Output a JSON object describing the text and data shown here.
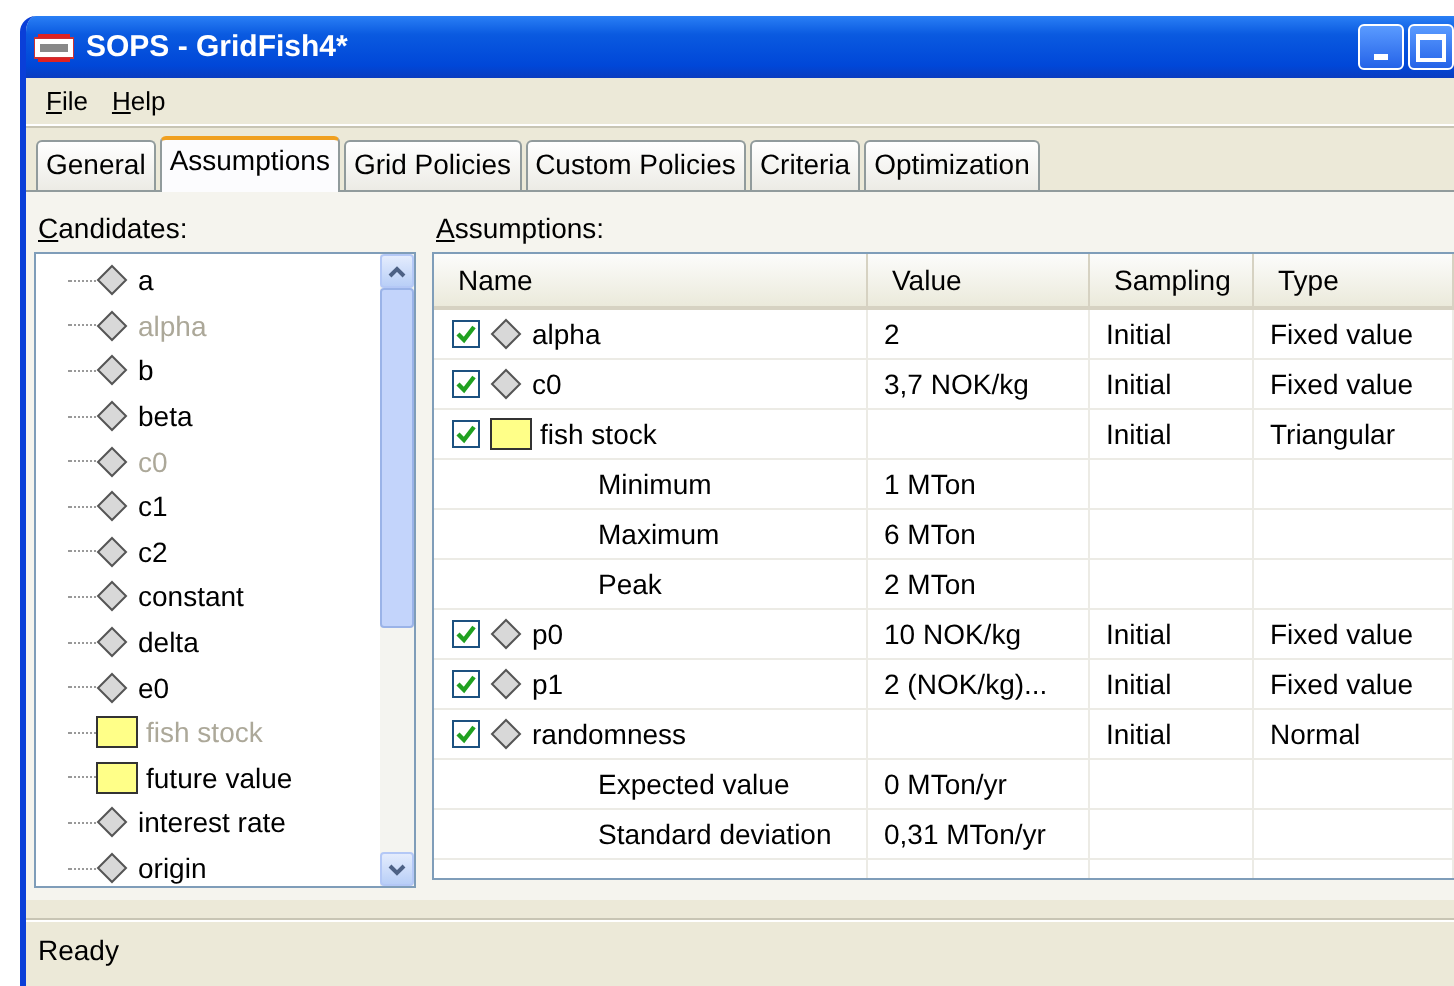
{
  "window": {
    "title": "SOPS - GridFish4*"
  },
  "menu": [
    "File",
    "Help"
  ],
  "tabs": [
    {
      "label": "General",
      "selected": false
    },
    {
      "label": "Assumptions",
      "selected": true
    },
    {
      "label": "Grid Policies",
      "selected": false
    },
    {
      "label": "Custom Policies",
      "selected": false
    },
    {
      "label": "Criteria",
      "selected": false
    },
    {
      "label": "Optimization",
      "selected": false
    }
  ],
  "candidates": {
    "label": "Candidates:",
    "items": [
      {
        "name": "a",
        "kind": "diamond",
        "disabled": false
      },
      {
        "name": "alpha",
        "kind": "diamond",
        "disabled": true
      },
      {
        "name": "b",
        "kind": "diamond",
        "disabled": false
      },
      {
        "name": "beta",
        "kind": "diamond",
        "disabled": false
      },
      {
        "name": "c0",
        "kind": "diamond",
        "disabled": true
      },
      {
        "name": "c1",
        "kind": "diamond",
        "disabled": false
      },
      {
        "name": "c2",
        "kind": "diamond",
        "disabled": false
      },
      {
        "name": "constant",
        "kind": "diamond",
        "disabled": false
      },
      {
        "name": "delta",
        "kind": "diamond",
        "disabled": false
      },
      {
        "name": "e0",
        "kind": "diamond",
        "disabled": false
      },
      {
        "name": "fish stock",
        "kind": "box",
        "disabled": true
      },
      {
        "name": "future value",
        "kind": "box",
        "disabled": false
      },
      {
        "name": "interest rate",
        "kind": "diamond",
        "disabled": false
      },
      {
        "name": "origin",
        "kind": "diamond",
        "disabled": false
      }
    ]
  },
  "assumptions": {
    "label": "Assumptions:",
    "columns": [
      "Name",
      "Value",
      "Sampling",
      "Type"
    ],
    "rows": [
      {
        "name": "alpha",
        "kind": "diamond",
        "checked": true,
        "value": "2",
        "sampling": "Initial",
        "type": "Fixed value"
      },
      {
        "name": "c0",
        "kind": "diamond",
        "checked": true,
        "value": "3,7 NOK/kg",
        "sampling": "Initial",
        "type": "Fixed value"
      },
      {
        "name": "fish stock",
        "kind": "box",
        "checked": true,
        "value": "",
        "sampling": "Initial",
        "type": "Triangular",
        "children": [
          {
            "name": "Minimum",
            "value": "1 MTon"
          },
          {
            "name": "Maximum",
            "value": "6 MTon"
          },
          {
            "name": "Peak",
            "value": "2 MTon"
          }
        ]
      },
      {
        "name": "p0",
        "kind": "diamond",
        "checked": true,
        "value": "10 NOK/kg",
        "sampling": "Initial",
        "type": "Fixed value"
      },
      {
        "name": "p1",
        "kind": "diamond",
        "checked": true,
        "value": "2 (NOK/kg)...",
        "sampling": "Initial",
        "type": "Fixed value"
      },
      {
        "name": "randomness",
        "kind": "diamond",
        "checked": true,
        "value": "",
        "sampling": "Initial",
        "type": "Normal",
        "children": [
          {
            "name": "Expected value",
            "value": "0 MTon/yr"
          },
          {
            "name": "Standard deviation",
            "value": "0,31 MTon/yr"
          }
        ]
      }
    ]
  },
  "status_bar": "Ready"
}
